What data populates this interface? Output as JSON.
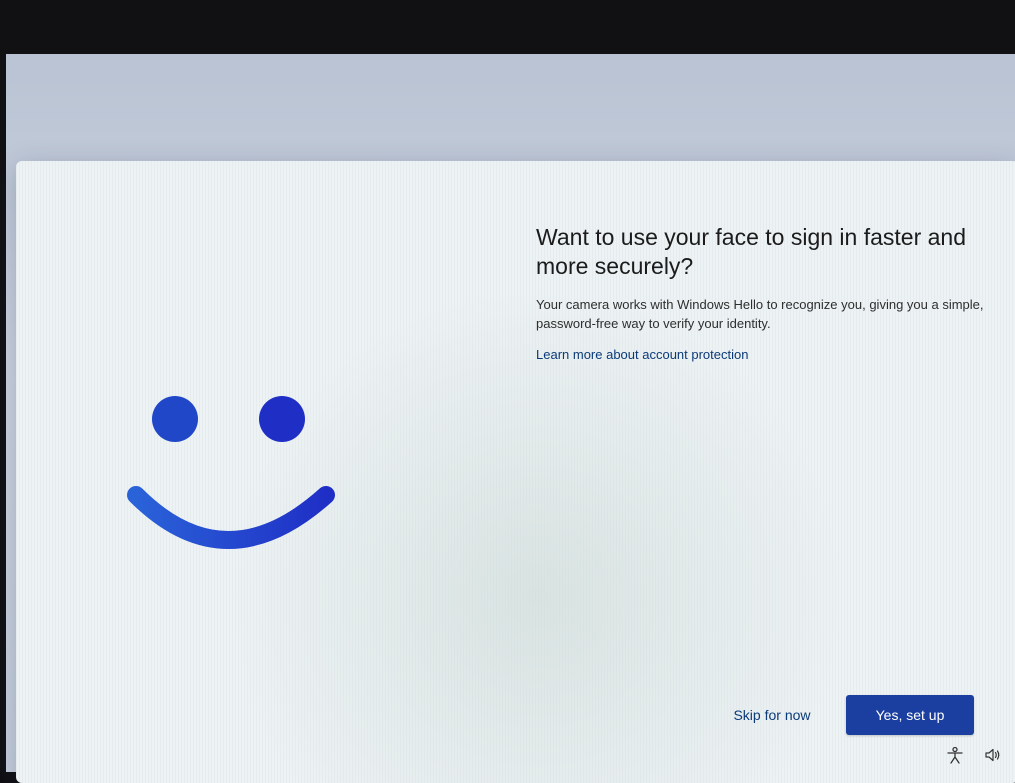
{
  "oobe": {
    "title": "Want to use your face to sign in faster and more securely?",
    "description": "Your camera works with Windows Hello to recognize you, giving you a simple, password-free way to verify your identity.",
    "learn_more_link": "Learn more about account protection",
    "skip_button": "Skip for now",
    "primary_button": "Yes, set up"
  },
  "colors": {
    "accent": "#1b3fa0",
    "smiley_dark": "#1f2fc6",
    "smiley_light": "#2a62d8",
    "card_background": "#edf2f4"
  },
  "tray": {
    "icons": [
      "accessibility-icon",
      "volume-icon"
    ]
  }
}
